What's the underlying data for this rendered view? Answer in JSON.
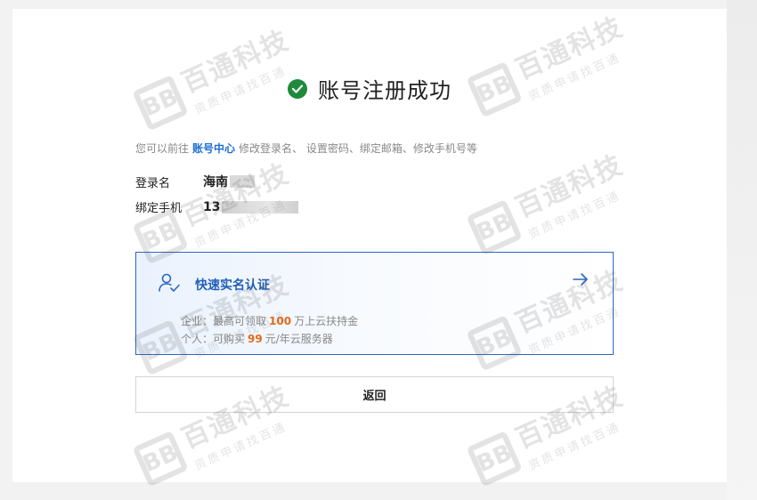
{
  "result": {
    "title": "账号注册成功",
    "icon": "check-circle-icon",
    "icon_color": "#1f8a3c"
  },
  "hint": {
    "prefix": "您可以前往",
    "link": "账号中心",
    "suffix": "修改登录名、 设置密码、绑定邮箱、修改手机号等"
  },
  "account": {
    "login_label": "登录名",
    "login_value": "海南",
    "phone_label": "绑定手机",
    "phone_value": "13"
  },
  "auth": {
    "title": "快速实名认证",
    "icon": "user-check-icon",
    "arrow_icon": "arrow-right-icon",
    "enterprise_prefix": "企业：最高可领取",
    "enterprise_num": "100",
    "enterprise_suffix": "万上云扶持金",
    "personal_prefix": "个人：可购买",
    "personal_num": "99",
    "personal_suffix": "元/年云服务器",
    "accent": "#2b66c4",
    "highlight": "#e36a1a"
  },
  "actions": {
    "back_label": "返回"
  },
  "watermark": {
    "logo": "BB",
    "main": "百通科技",
    "sub": "资质申请找百通"
  }
}
